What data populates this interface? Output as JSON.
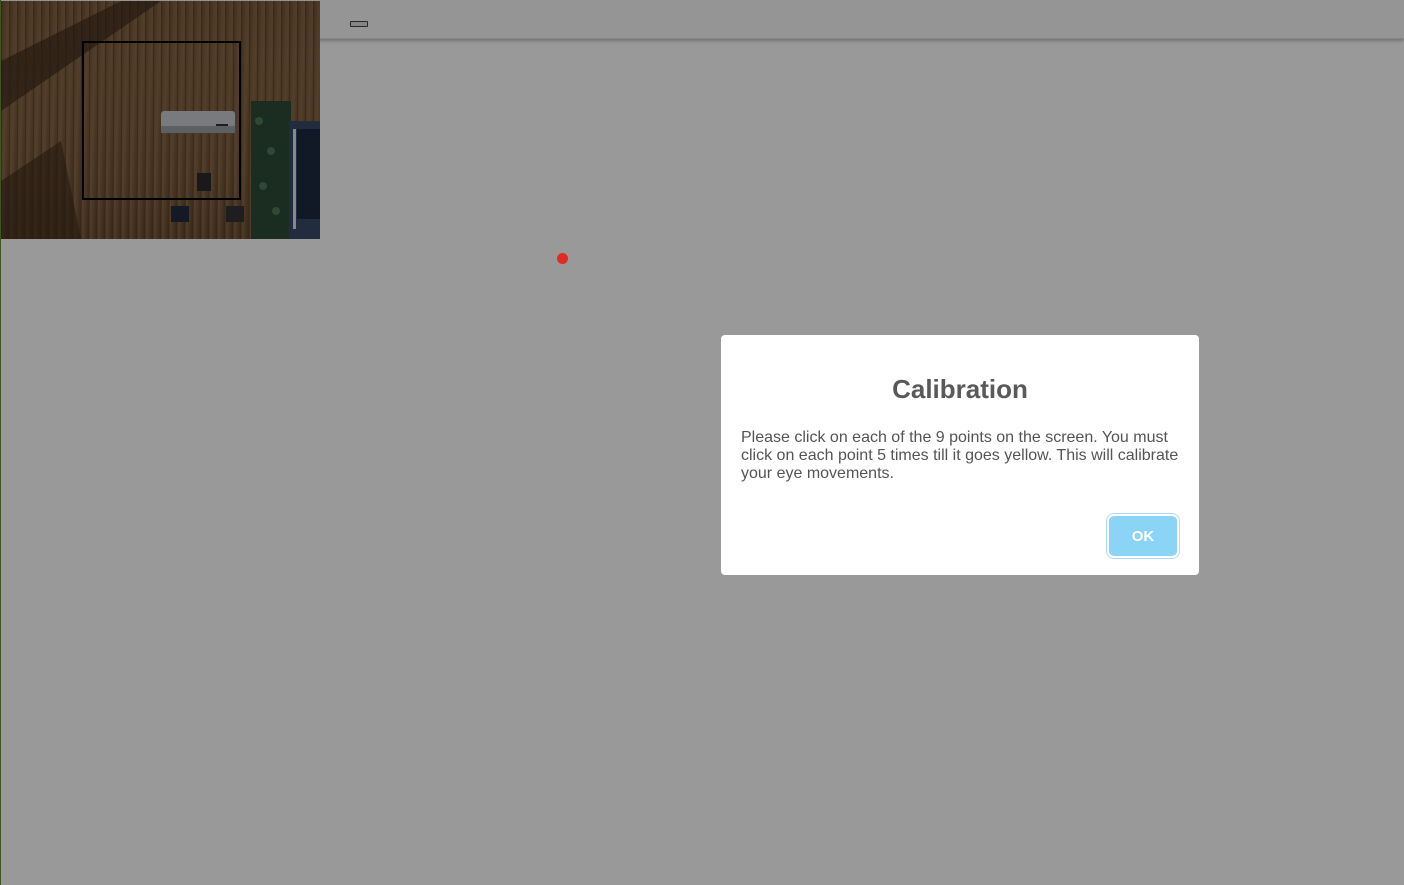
{
  "navbar": {
    "toggle_icon": "navbar-toggle-icon"
  },
  "webcam": {
    "description_icon": "webcam-video-feed"
  },
  "calibration_point": {
    "color": "#e02a22"
  },
  "modal": {
    "title": "Calibration",
    "text": "Please click on each of the 9 points on the screen. You must click on each point 5 times till it goes yellow. This will calibrate your eye movements.",
    "ok_label": "OK",
    "button_color": "#8cd4f5"
  },
  "colors": {
    "overlay": "rgba(0,0,0,0.4)",
    "title_text": "#595959",
    "body_text": "#545454"
  }
}
